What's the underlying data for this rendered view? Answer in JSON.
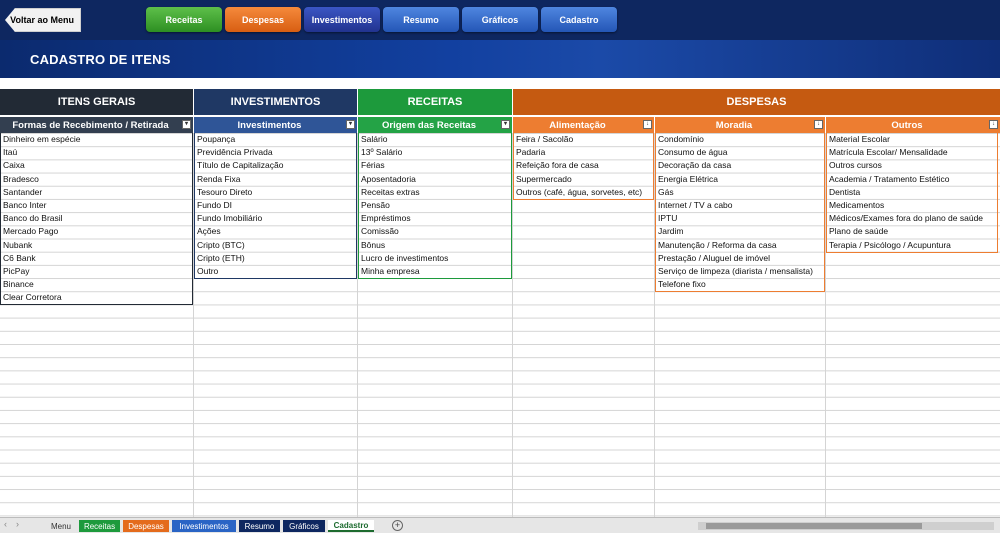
{
  "topbar": {
    "back_label": "Voltar ao Menu",
    "nav": [
      "Receitas",
      "Despesas",
      "Investimentos",
      "Resumo",
      "Gráficos",
      "Cadastro"
    ]
  },
  "page": {
    "title": "CADASTRO DE ITENS"
  },
  "sections": [
    "ITENS GERAIS",
    "INVESTIMENTOS",
    "RECEITAS",
    "DESPESAS"
  ],
  "columns": [
    {
      "header": "Formas de Recebimento / Retirada",
      "items": [
        "Dinheiro em espécie",
        "Itaú",
        "Caixa",
        "Bradesco",
        "Santander",
        "Banco Inter",
        "Banco do Brasil",
        "Mercado Pago",
        "Nubank",
        "C6 Bank",
        "PicPay",
        "Binance",
        "Clear Corretora"
      ]
    },
    {
      "header": "Investimentos",
      "items": [
        "Poupança",
        "Previdência Privada",
        "Título de Capitalização",
        "Renda Fixa",
        "Tesouro Direto",
        "Fundo DI",
        "Fundo Imobiliário",
        "Ações",
        "Cripto (BTC)",
        "Cripto (ETH)",
        "Outro"
      ]
    },
    {
      "header": "Origem das Receitas",
      "items": [
        "Salário",
        "13º Salário",
        "Férias",
        "Aposentadoria",
        "Receitas extras",
        "Pensão",
        "Empréstimos",
        "Comissão",
        "Bônus",
        "Lucro de investimentos",
        "Minha empresa"
      ]
    },
    {
      "header": "Alimentação",
      "items": [
        "Feira  / Sacolão",
        "Padaria",
        "Refeição fora de casa",
        "Supermercado",
        "Outros (café, água, sorvetes, etc)"
      ]
    },
    {
      "header": "Moradia",
      "items": [
        "Condomínio",
        "Consumo de água",
        "Decoração da casa",
        "Energia Elétrica",
        "Gás",
        "Internet / TV a cabo",
        "IPTU",
        "Jardim",
        "Manutenção / Reforma da casa",
        "Prestação / Aluguel de imóvel",
        "Serviço de limpeza (diarista / mensalista)",
        "Telefone fixo"
      ]
    },
    {
      "header": "Outros",
      "items": [
        "Material Escolar",
        "Matrícula Escolar/ Mensalidade",
        "Outros cursos",
        "Academia / Tratamento Estético",
        "Dentista",
        "Medicamentos",
        "Médicos/Exames fora do plano de saúde",
        "Plano de saúde",
        "Terapia / Psicólogo  / Acupuntura"
      ]
    }
  ],
  "sheet_tabs": [
    "Menu",
    "Receitas",
    "Despesas",
    "Investimentos",
    "Resumo",
    "Gráficos",
    "Cadastro"
  ],
  "sheet_nav": {
    "prev": "‹",
    "next": "›",
    "add": "+"
  },
  "colors": {
    "navy": "#0e2760",
    "green": "#1d9a3c",
    "orange": "#e46b1c",
    "blue": "#2a64c5",
    "dark": "#222a35"
  }
}
